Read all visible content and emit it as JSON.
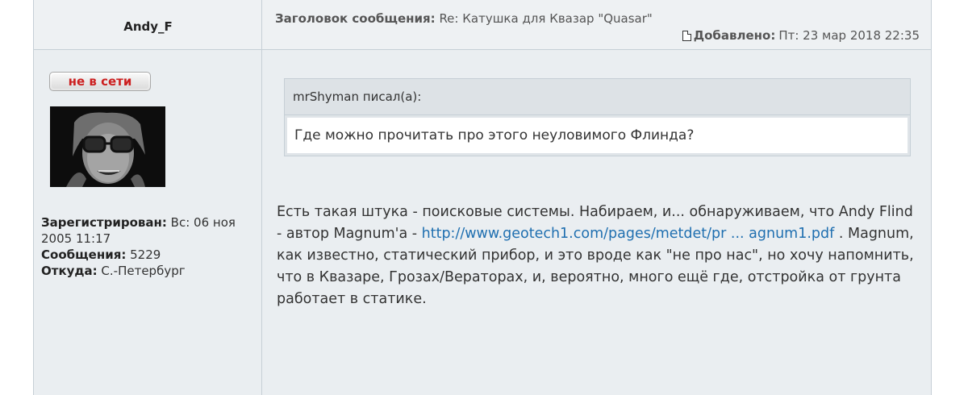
{
  "author": {
    "name": "Andy_F"
  },
  "post_header": {
    "subject_label": "Заголовок сообщения:",
    "subject_value": "Re: Катушка для Квазар \"Quasar\"",
    "date_label": "Добавлено:",
    "date_value": "Пт: 23 мар 2018 22:35"
  },
  "profile": {
    "status": "не в сети",
    "registered_label": "Зарегистрирован:",
    "registered_value": "Вс: 06 ноя 2005 11:17",
    "posts_label": "Сообщения:",
    "posts_value": "5229",
    "location_label": "Откуда:",
    "location_value": "С.-Петербург"
  },
  "quote": {
    "header": "mrShyman писал(а):",
    "text": "Где можно прочитать про этого неуловимого Флинда?"
  },
  "message": {
    "part1": "Есть такая штука - поисковые системы. Набираем, и... обнаруживаем, что Andy Flind - автор Magnum'а - ",
    "link_text": "http://www.geotech1.com/pages/metdet/pr ... agnum1.pdf",
    "part2": " . Magnum, как известно, статический прибор, и это вроде как \"не про нас\", но хочу напомнить, что в Квазаре, Грозах/Вераторах, и, вероятно, много ещё где, отстройка от грунта работает в статике."
  },
  "colors": {
    "link": "#1f6fb0",
    "offline": "#cc1f1f",
    "panel": "#eaeef1"
  }
}
